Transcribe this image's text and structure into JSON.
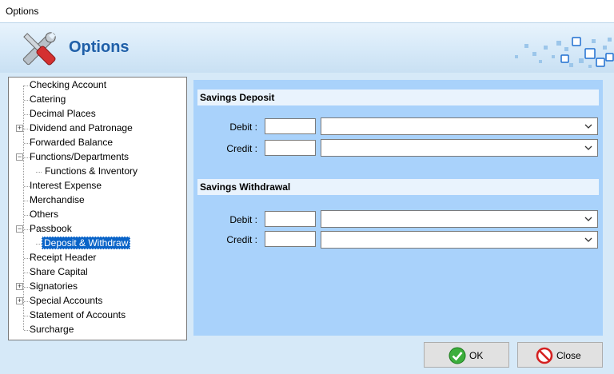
{
  "window": {
    "title": "Options"
  },
  "header": {
    "title": "Options"
  },
  "tree": {
    "items": [
      {
        "label": "Checking Account"
      },
      {
        "label": "Catering"
      },
      {
        "label": "Decimal Places"
      },
      {
        "label": "Dividend and Patronage"
      },
      {
        "label": "Forwarded Balance"
      },
      {
        "label": "Functions/Departments"
      },
      {
        "label": "Functions & Inventory"
      },
      {
        "label": "Interest Expense"
      },
      {
        "label": "Merchandise"
      },
      {
        "label": "Others"
      },
      {
        "label": "Passbook"
      },
      {
        "label": "Deposit & Withdraw"
      },
      {
        "label": "Receipt Header"
      },
      {
        "label": "Share Capital"
      },
      {
        "label": "Signatories"
      },
      {
        "label": "Special Accounts"
      },
      {
        "label": "Statement of Accounts"
      },
      {
        "label": "Surcharge"
      }
    ]
  },
  "deposit": {
    "title": "Savings Deposit",
    "debit_label": "Debit :",
    "credit_label": "Credit :",
    "debit_code": "",
    "credit_code": "",
    "debit_account": "",
    "credit_account": ""
  },
  "withdrawal": {
    "title": "Savings Withdrawal",
    "debit_label": "Debit :",
    "credit_label": "Credit :",
    "debit_code": "",
    "credit_code": "",
    "debit_account": "",
    "credit_account": ""
  },
  "buttons": {
    "ok": "OK",
    "close": "Close"
  }
}
